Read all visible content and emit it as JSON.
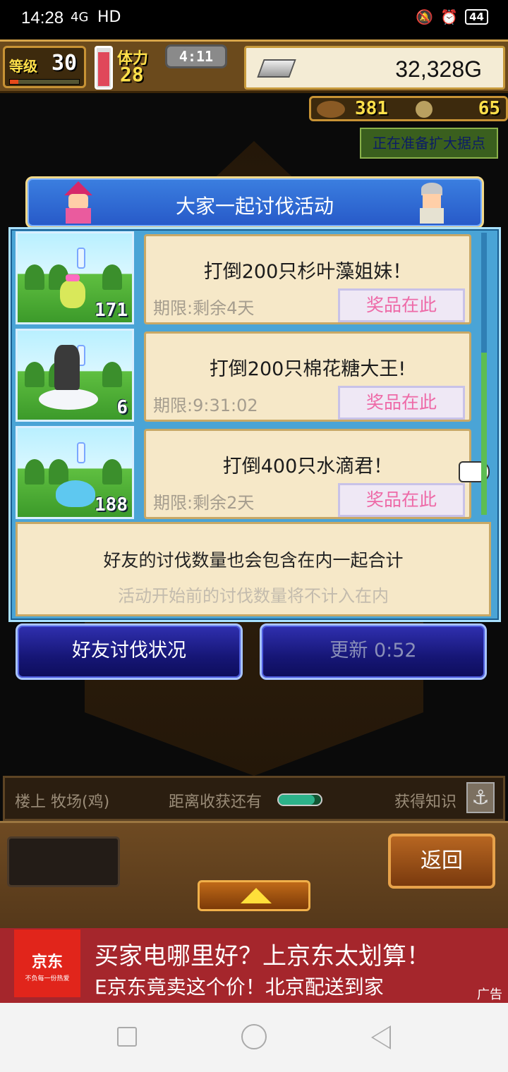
{
  "status_bar": {
    "time": "14:28",
    "network": "4G",
    "wifi_label": "HD",
    "battery": "44"
  },
  "hud": {
    "level_label": "等级",
    "level": "30",
    "stamina_label": "体力",
    "stamina": "28",
    "timer": "4:11",
    "gold": "32,328G",
    "resource1": "381",
    "resource2": "65",
    "notice": "正在准备扩大据点"
  },
  "dialog": {
    "title": "大家一起讨伐活动",
    "events": [
      {
        "title": "打倒200只杉叶藻姐妹！",
        "deadline": "期限:剩余4天",
        "prize": "奖品在此",
        "count": "171"
      },
      {
        "title": "打倒200只棉花糖大王!",
        "deadline": "期限:9:31:02",
        "prize": "奖品在此",
        "count": "6"
      },
      {
        "title": "打倒400只水滴君！",
        "deadline": "期限:剩余2天",
        "prize": "奖品在此",
        "count": "188"
      }
    ],
    "info_line1": "好友的讨伐数量也会包含在内一起合计",
    "info_line2": "活动开始前的讨伐数量将不计入在内",
    "friend_status_button": "好友讨伐状况",
    "update_button": "更新 0:52"
  },
  "strip": {
    "location": "楼上 牧场(鸡)",
    "harvest_label": "距离收获还有",
    "harvest_progress": 0.85,
    "knowledge_label": "获得知识"
  },
  "bottom": {
    "back_button": "返回"
  },
  "ad": {
    "brand": "京东",
    "slogan": "不负每一份热爱",
    "headline": "买家电哪里好？上京东太划算！",
    "subline": "E京东竟卖这个价！北京配送到家",
    "tag": "广告"
  },
  "colors": {
    "dialog_blue": "#4aa4d6",
    "prize_pink": "#ee6aa7",
    "card_bg": "#f6e8c8",
    "ad_red": "#a5262c"
  }
}
